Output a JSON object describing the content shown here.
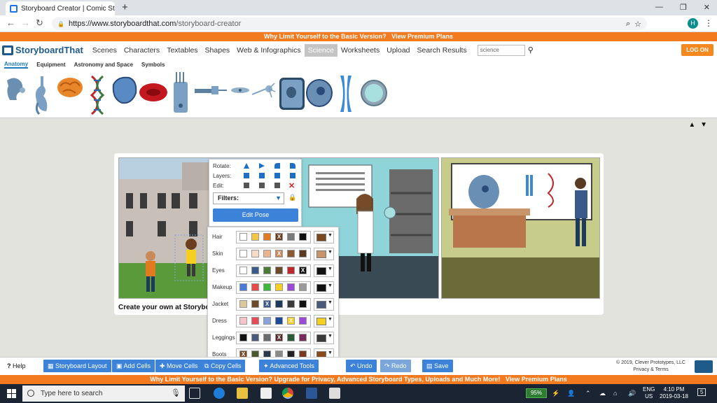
{
  "browser": {
    "tab_title": "Storyboard Creator | Comic Strip",
    "new_tab": "+",
    "win_min": "—",
    "win_max": "❐",
    "win_close": "✕",
    "url_host": "https://www.storyboardthat.com",
    "url_path": "/storyboard-creator",
    "avatar": "H",
    "back": "←",
    "forward": "→",
    "reload": "↻",
    "lock": "🔒",
    "zoom": "⌕",
    "star": "☆",
    "menu": "⋮"
  },
  "promo_top": {
    "text": "Why Limit Yourself to the Basic Version?",
    "link": "View Premium Plans"
  },
  "nav": {
    "logo": "StoryboardThat",
    "items": [
      "Scenes",
      "Characters",
      "Textables",
      "Shapes",
      "Web & Infographics",
      "Science",
      "Worksheets",
      "Upload",
      "Search Results"
    ],
    "active": "Science",
    "search_value": "science",
    "search_icon": "magnifier-icon",
    "login": "LOG ON"
  },
  "subtabs": {
    "items": [
      "Anatomy",
      "Equipment",
      "Astronomy and Space",
      "Symbols"
    ],
    "active": "Anatomy"
  },
  "item_icons": [
    "ear",
    "stomach",
    "brain",
    "dna",
    "organ",
    "red-blood-cell",
    "test-tubes",
    "syringe",
    "neuron",
    "nerve-cell",
    "plant-cell",
    "animal-cell",
    "chromosome",
    "cell-dish"
  ],
  "scroll": {
    "up": "▲",
    "down": "▼"
  },
  "storyboard": {
    "caption": "Create your own at Storyboard That"
  },
  "popup": {
    "rotate": "Rotate:",
    "layers": "Layers:",
    "edit": "Edit:",
    "filters": "Filters:",
    "edit_pose": "Edit Pose",
    "arrow": "▼",
    "lock": "🔒"
  },
  "colors": {
    "rows": [
      {
        "label": "Hair",
        "swatches": [
          "#ffffff",
          "#f4c542",
          "#e07b1f",
          "#6b3f1d",
          "#7a7a7a",
          "#111111"
        ],
        "selected": 3,
        "current": "#7a4a1e"
      },
      {
        "label": "Skin",
        "swatches": [
          "#ffffff",
          "#f5dcc7",
          "#e8b58f",
          "#c98a5b",
          "#8a5a35",
          "#5a3a22"
        ],
        "selected": 3,
        "current": "#c8956a"
      },
      {
        "label": "Eyes",
        "swatches": [
          "#ffffff",
          "#3b5a8a",
          "#4d7a3a",
          "#6b4a2a",
          "#c0272d",
          "#111111"
        ],
        "selected": 5,
        "current": "#111111"
      },
      {
        "label": "Makeup",
        "swatches": [
          "#4a7ad8",
          "#e84a4a",
          "#3db83d",
          "#f5d020",
          "#9b4ad8",
          "#9a9a9a"
        ],
        "selected": -1,
        "current": "#111111"
      },
      {
        "label": "Jacket",
        "swatches": [
          "#d8c89a",
          "#6b4a2a",
          "#3b5a8a",
          "#1e3a5a",
          "#3a3a3a",
          "#111111"
        ],
        "selected": 2,
        "current": "#4a5a7a"
      },
      {
        "label": "Dress",
        "swatches": [
          "#f5c4c8",
          "#e84a5a",
          "#8aa4d8",
          "#1e4a9a",
          "#f5d020",
          "#9b4ad8"
        ],
        "selected": 4,
        "current": "#f5d020"
      },
      {
        "label": "Leggings",
        "swatches": [
          "#111111",
          "#4a5a7a",
          "#6b6b6b",
          "#5a2a2a",
          "#2a5a3a",
          "#7a2a5a"
        ],
        "selected": 3,
        "current": "#3a3a3a"
      },
      {
        "label": "Boots",
        "swatches": [
          "#7a4a1e",
          "#4a5a2a",
          "#2a3a4a",
          "#8a8a8a",
          "#222222",
          "#7a3a1e"
        ],
        "selected": 0,
        "current": "#8a4a1a"
      }
    ]
  },
  "toolbar": {
    "help": "Help",
    "storyboard_layout": "Storyboard Layout",
    "add_cells": "Add Cells",
    "move_cells": "Move Cells",
    "copy_cells": "Copy Cells",
    "advanced_tools": "Advanced Tools",
    "undo": "Undo",
    "redo": "Redo",
    "save": "Save",
    "copyright": "© 2019, Clever Prototypes, LLC",
    "privacy": "Privacy & Terms"
  },
  "promo_bottom": {
    "text": "Why Limit Yourself to the Basic Version? Upgrade for Privacy, Advanced Storyboard Types, Uploads and Much More!",
    "link": "View Premium Plans"
  },
  "taskbar": {
    "search": "Type here to search",
    "battery": "95%",
    "lang1": "ENG",
    "lang2": "US",
    "time": "4:10 PM",
    "date": "2019-03-18",
    "notif": "5"
  }
}
